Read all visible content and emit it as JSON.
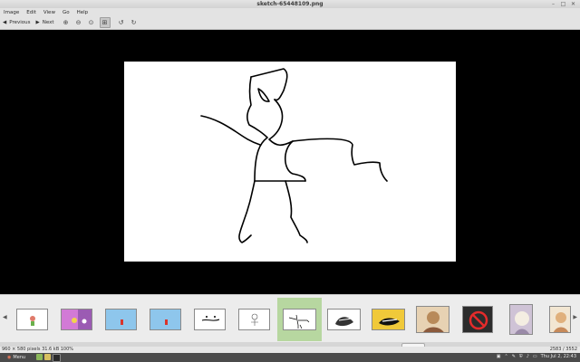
{
  "window": {
    "title": "sketch-65448109.png",
    "min": "–",
    "max": "□",
    "close": "✕"
  },
  "menu": [
    "Image",
    "Edit",
    "View",
    "Go",
    "Help"
  ],
  "toolbar": {
    "previous": "Previous",
    "next": "Next"
  },
  "status": {
    "info": "960 × 580 pixels  31.6 kB   100%",
    "position": "2583 / 3552"
  },
  "taskbar": {
    "menu_label": "Menu",
    "datetime": "Thu Jul  2, 22:43"
  },
  "colors": {
    "viewer_bg": "#000000",
    "selected_thumb": "#b7d7a0",
    "taskbar": "#4b4b4b"
  }
}
